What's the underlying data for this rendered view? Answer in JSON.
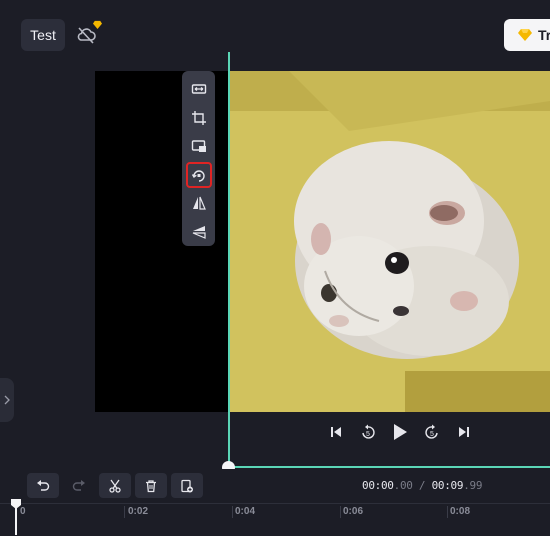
{
  "project": {
    "title": "Test"
  },
  "header": {
    "upgrade_label": "Tr"
  },
  "preview": {
    "toolbar": [
      {
        "name": "fit-icon",
        "selected": false
      },
      {
        "name": "crop-icon",
        "selected": false
      },
      {
        "name": "picture-in-picture-icon",
        "selected": false
      },
      {
        "name": "rotate-icon",
        "selected": true
      },
      {
        "name": "flip-horizontal-icon",
        "selected": false
      },
      {
        "name": "flip-vertical-icon",
        "selected": false
      }
    ]
  },
  "player": {
    "current_time_main": "00:00",
    "current_time_frac": ".00",
    "separator": "/",
    "total_time_main": "00:09",
    "total_time_frac": ".99",
    "skip_back_label": "5",
    "skip_forward_label": "5"
  },
  "timeline": {
    "ticks": [
      {
        "label": "0"
      },
      {
        "label": "0:02"
      },
      {
        "label": "0:04"
      },
      {
        "label": "0:06"
      },
      {
        "label": "0:08"
      }
    ]
  },
  "colors": {
    "accent": "#5bd6b6",
    "highlight": "#e02424",
    "gem": "#f5b800"
  }
}
